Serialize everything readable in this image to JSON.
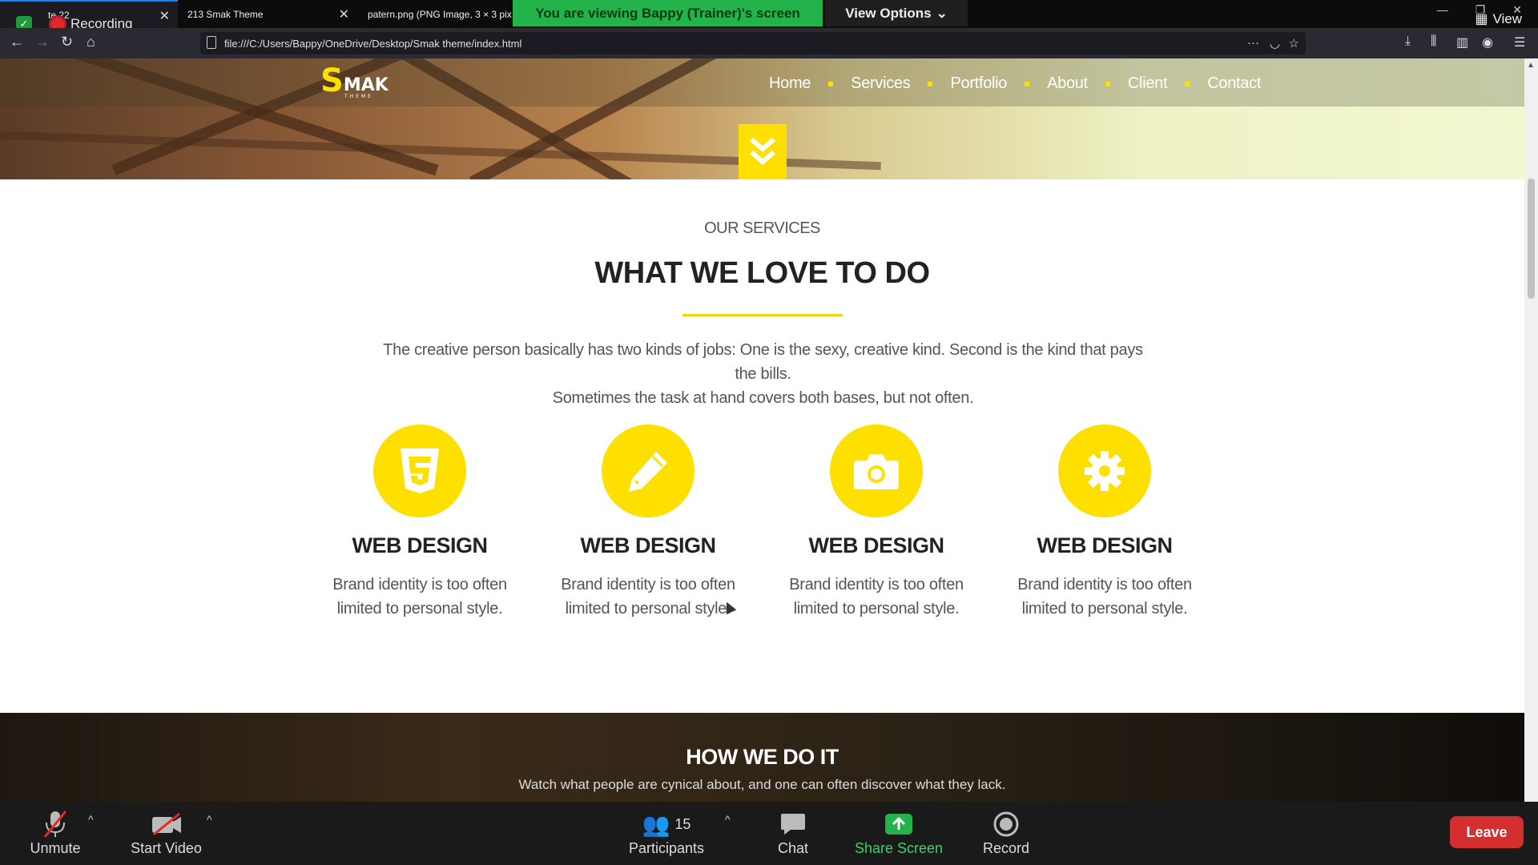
{
  "browser": {
    "tabs": [
      {
        "label": "te 22"
      },
      {
        "label": "213 Smak Theme"
      },
      {
        "label": "patern.png (PNG Image, 3 × 3 pixe"
      }
    ],
    "recording_label": "Recording",
    "url": "file:///C:/Users/Bappy/OneDrive/Desktop/Smak theme/index.html",
    "view_label": "View"
  },
  "zoom": {
    "banner": "You are viewing Bappy (Trainer)'s screen",
    "view_options": "View Options",
    "toolbar": {
      "unmute": "Unmute",
      "start_video": "Start Video",
      "participants": "Participants",
      "participants_count": "15",
      "chat": "Chat",
      "share_screen": "Share Screen",
      "record": "Record",
      "leave": "Leave"
    }
  },
  "site": {
    "logo_letter": "S",
    "logo_text": "MAK",
    "logo_sub": "THEME",
    "nav": [
      "Home",
      "Services",
      "Portfolio",
      "About",
      "Client",
      "Contact"
    ],
    "services": {
      "eyebrow": "OUR SERVICES",
      "heading": "WHAT WE LOVE TO DO",
      "description_line1": "The creative person basically has two kinds of jobs: One is the sexy, creative kind. Second is the kind that pays the bills.",
      "description_line2": "Sometimes the task at hand covers both bases, but not often.",
      "cards": [
        {
          "icon": "css3-icon",
          "title": "WEB DESIGN",
          "text_line1": "Brand identity is too often",
          "text_line2": "limited to personal style."
        },
        {
          "icon": "pencil-icon",
          "title": "WEB DESIGN",
          "text_line1": "Brand identity is too often",
          "text_line2": "limited to personal style."
        },
        {
          "icon": "camera-icon",
          "title": "WEB DESIGN",
          "text_line1": "Brand identity is too often",
          "text_line2": "limited to personal style."
        },
        {
          "icon": "gear-icon",
          "title": "WEB DESIGN",
          "text_line1": "Brand identity is too often",
          "text_line2": "limited to personal style."
        }
      ]
    },
    "how": {
      "title": "HOW WE DO IT",
      "subtitle": "Watch what people are cynical about, and one can often discover what they lack."
    }
  },
  "colors": {
    "accent": "#fde000",
    "zoom_green": "#24b24a",
    "leave_red": "#d52e2e"
  }
}
